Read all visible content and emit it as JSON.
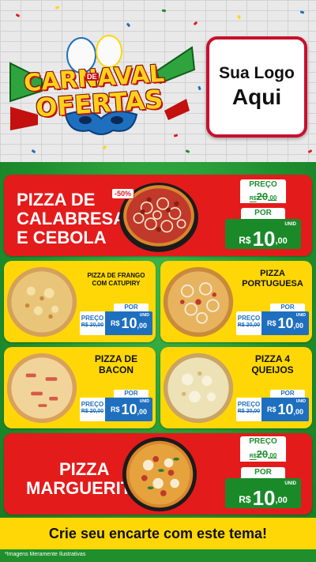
{
  "header": {
    "campaign_title": "CARNAVAL",
    "campaign_connector": "DE",
    "campaign_subtitle": "OFERTAS",
    "logo_placeholder_line1": "Sua Logo",
    "logo_placeholder_line2": "Aqui"
  },
  "colors": {
    "red": "#e41b1b",
    "yellow": "#ffd707",
    "green": "#1f8f2e",
    "blue": "#1f6fbf"
  },
  "products": [
    {
      "name_line1": "PIZZA DE",
      "name_line2": "CALABRESA",
      "name_line3": "E CEBOLA",
      "discount_badge": "-50%",
      "preco_label": "PREÇO",
      "old_price_currency": "R$",
      "old_price_int": "20",
      "old_price_dec": ",00",
      "por_label": "POR",
      "currency": "R$",
      "price_int": "10",
      "price_dec": ",00",
      "unit": "UNID"
    },
    {
      "name_line1": "PIZZA DE FRANGO",
      "name_line2": "COM CATUPIRY",
      "preco_label": "PREÇO",
      "old_price": "R$ 20,00",
      "por_label": "POR",
      "currency": "R$",
      "price_int": "10",
      "price_dec": ",00",
      "unit": "UNID"
    },
    {
      "name_line1": "PIZZA",
      "name_line2": "PORTUGUESA",
      "preco_label": "PREÇO",
      "old_price": "R$ 20,00",
      "por_label": "POR",
      "currency": "R$",
      "price_int": "10",
      "price_dec": ",00",
      "unit": "UNID"
    },
    {
      "name_line1": "PIZZA DE",
      "name_line2": "BACON",
      "preco_label": "PREÇO",
      "old_price": "R$ 20,00",
      "por_label": "POR",
      "currency": "R$",
      "price_int": "10",
      "price_dec": ",00",
      "unit": "UNID"
    },
    {
      "name_line1": "PIZZA 4",
      "name_line2": "QUEIJOS",
      "preco_label": "PREÇO",
      "old_price": "R$ 20,00",
      "por_label": "POR",
      "currency": "R$",
      "price_int": "10",
      "price_dec": ",00",
      "unit": "UNID"
    },
    {
      "name_line1": "PIZZA",
      "name_line2": "MARGUERITA",
      "preco_label": "PREÇO",
      "old_price_currency": "R$",
      "old_price_int": "20",
      "old_price_dec": ",00",
      "por_label": "POR",
      "currency": "R$",
      "price_int": "10",
      "price_dec": ",00",
      "unit": "UNID"
    }
  ],
  "footer": {
    "cta": "Crie seu encarte com este tema!",
    "disclaimer": "*Imagens Meramente Ilustrativas"
  }
}
